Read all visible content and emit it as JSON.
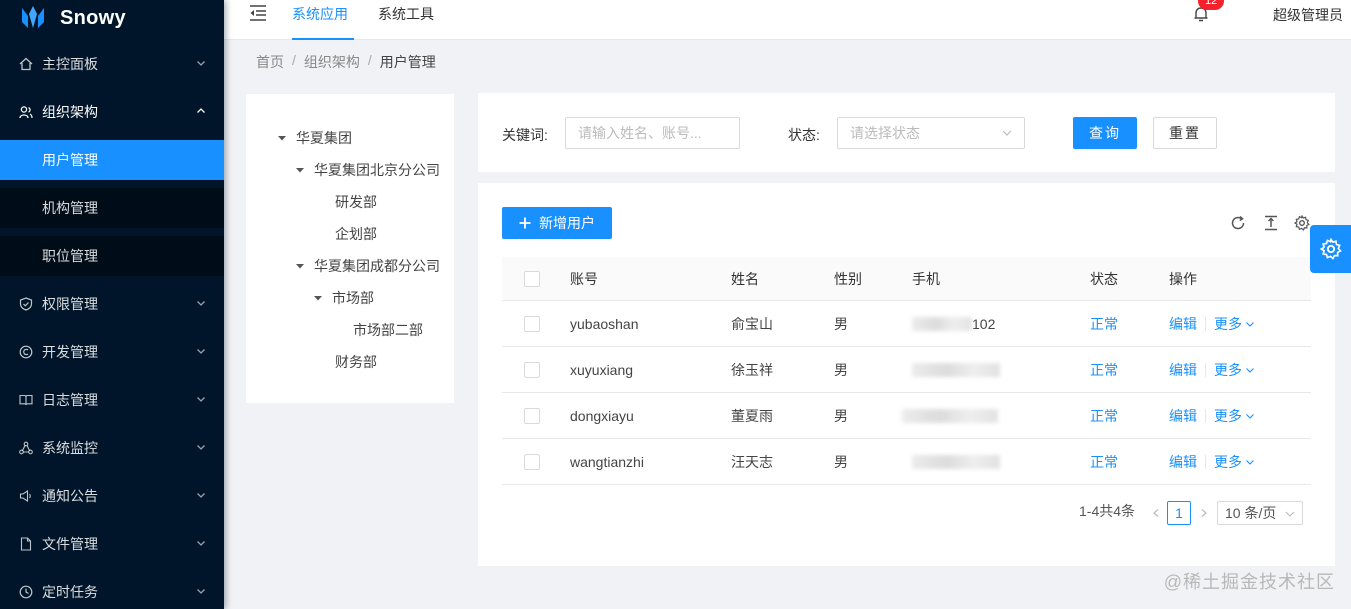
{
  "app": {
    "name": "Snowy"
  },
  "sidebar": {
    "items": [
      {
        "label": "主控面板",
        "icon": "home-icon",
        "expanded": false
      },
      {
        "label": "组织架构",
        "icon": "team-icon",
        "expanded": true,
        "children": [
          {
            "label": "用户管理",
            "active": true
          },
          {
            "label": "机构管理"
          },
          {
            "label": "职位管理"
          }
        ]
      },
      {
        "label": "权限管理",
        "icon": "shield-icon",
        "expanded": false
      },
      {
        "label": "开发管理",
        "icon": "copyright-icon",
        "expanded": false
      },
      {
        "label": "日志管理",
        "icon": "book-icon",
        "expanded": false
      },
      {
        "label": "系统监控",
        "icon": "network-icon",
        "expanded": false
      },
      {
        "label": "通知公告",
        "icon": "sound-icon",
        "expanded": false
      },
      {
        "label": "文件管理",
        "icon": "file-icon",
        "expanded": false
      },
      {
        "label": "定时任务",
        "icon": "clock-icon",
        "expanded": false
      }
    ]
  },
  "header": {
    "tabs": [
      {
        "label": "系统应用",
        "active": true
      },
      {
        "label": "系统工具",
        "active": false
      }
    ],
    "notification_count": "12",
    "user": "超级管理员"
  },
  "breadcrumb": [
    "首页",
    "组织架构",
    "用户管理"
  ],
  "org_tree": [
    {
      "label": "华夏集团",
      "expanded": true
    },
    {
      "label": "华夏集团北京分公司",
      "expanded": true
    },
    {
      "label": "研发部"
    },
    {
      "label": "企划部"
    },
    {
      "label": "华夏集团成都分公司",
      "expanded": true
    },
    {
      "label": "市场部",
      "expanded": true
    },
    {
      "label": "市场部二部"
    },
    {
      "label": "财务部"
    }
  ],
  "search": {
    "keyword_label": "关键词:",
    "keyword_placeholder": "请输入姓名、账号...",
    "status_label": "状态:",
    "status_placeholder": "请选择状态",
    "query_label": "查询",
    "reset_label": "重置"
  },
  "table": {
    "add_label": "新增用户",
    "columns": [
      "账号",
      "姓名",
      "性别",
      "手机",
      "状态",
      "操作"
    ],
    "rows": [
      {
        "account": "yubaoshan",
        "name": "俞宝山",
        "gender": "男",
        "phone": "102",
        "status": "正常",
        "edit": "编辑",
        "more": "更多"
      },
      {
        "account": "xuyuxiang",
        "name": "徐玉祥",
        "gender": "男",
        "phone": "",
        "status": "正常",
        "edit": "编辑",
        "more": "更多"
      },
      {
        "account": "dongxiayu",
        "name": "董夏雨",
        "gender": "男",
        "phone": "",
        "status": "正常",
        "edit": "编辑",
        "more": "更多"
      },
      {
        "account": "wangtianzhi",
        "name": "汪天志",
        "gender": "男",
        "phone": "",
        "status": "正常",
        "edit": "编辑",
        "more": "更多"
      }
    ]
  },
  "pagination": {
    "summary": "1-4共4条",
    "current_page": "1",
    "page_size": "10 条/页"
  },
  "watermark": "@稀土掘金技术社区",
  "colors": {
    "primary": "#1890ff",
    "sidebar_bg": "#001529",
    "sidebar_sub_bg": "#000c17",
    "badge": "#f5222d"
  }
}
